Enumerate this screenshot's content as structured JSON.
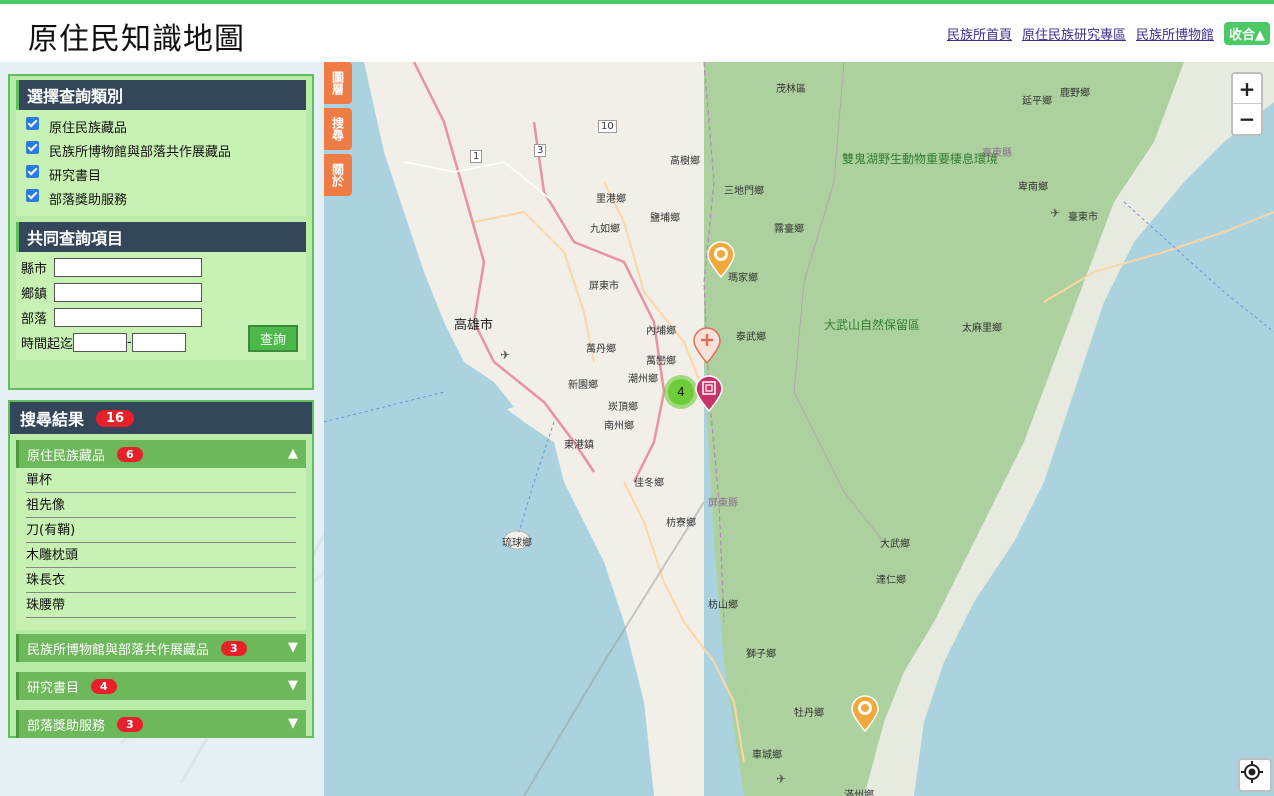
{
  "header": {
    "title": "原住民知識地圖",
    "links": [
      "民族所首頁",
      "原住民族研究專區",
      "民族所博物館"
    ],
    "collapse_label": "收合▲"
  },
  "category_panel": {
    "title": "選擇查詢類別",
    "options": [
      {
        "label": "原住民族藏品",
        "checked": true
      },
      {
        "label": "民族所博物館與部落共作展藏品",
        "checked": true
      },
      {
        "label": "研究書目",
        "checked": true
      },
      {
        "label": "部落獎助服務",
        "checked": true
      }
    ]
  },
  "query_panel": {
    "title": "共同查詢項目",
    "county_label": "縣市",
    "township_label": "鄉鎮",
    "tribe_label": "部落",
    "time_label": "時間起迄",
    "time_separator": "-",
    "submit_label": "查詢"
  },
  "results": {
    "title": "搜尋結果",
    "total": "16",
    "groups": [
      {
        "label": "原住民族藏品",
        "count": "6",
        "expanded": true,
        "arrow": "▲",
        "items": [
          "單杯",
          "祖先像",
          "刀(有鞘)",
          "木雕枕頭",
          "珠長衣",
          "珠腰帶"
        ]
      },
      {
        "label": "民族所博物館與部落共作展藏品",
        "count": "3",
        "expanded": false,
        "arrow": "▼"
      },
      {
        "label": "研究書目",
        "count": "4",
        "expanded": false,
        "arrow": "▼"
      },
      {
        "label": "部落獎助服務",
        "count": "3",
        "expanded": false,
        "arrow": "▼"
      }
    ]
  },
  "map": {
    "side_tabs": [
      "圖層",
      "搜尋",
      "關於"
    ],
    "zoom_in": "+",
    "zoom_out": "−",
    "cluster_count": "4",
    "labels": {
      "maolin": "茂林區",
      "yanping": "延平鄉",
      "luye": "鹿野鄉",
      "gaoshu": "高樹鄉",
      "sandimen": "三地門鄉",
      "ligang": "里港鄉",
      "yanpu": "鹽埔鄉",
      "jiuru": "九如鄉",
      "wutai": "霧臺鄉",
      "shuangui": "雙鬼湖野生動物重要棲息環境",
      "taitung_county": "臺東縣",
      "beinan": "卑南鄉",
      "taitung_city": "臺東市",
      "majia": "瑪家鄉",
      "pingtung_city": "屏東市",
      "kaohsiung": "高雄市",
      "neipu": "內埔鄉",
      "taiwu": "泰武鄉",
      "dawu_reserve": "大武山自然保留區",
      "taimali": "太麻里鄉",
      "wandan": "萬丹鄉",
      "wanluan": "萬巒鄉",
      "chaozhou": "潮州鄉",
      "xinyuan": "新園鄉",
      "kanding": "崁頂鄉",
      "nanzhou": "南州鄉",
      "donggang": "東港鎮",
      "jiadong": "佳冬鄉",
      "pingtung_county": "屏東縣",
      "fangliao": "枋寮鄉",
      "liuqiu": "琉球鄉",
      "dawu": "大武鄉",
      "daren": "達仁鄉",
      "fangshan": "枋山鄉",
      "shizi": "獅子鄉",
      "mudan": "牡丹鄉",
      "checheng": "車城鄉",
      "manzhou": "滿州鄉",
      "r1": "1",
      "r3": "3",
      "r10": "10"
    }
  },
  "colors": {
    "accent": "#4cc964",
    "panel_header": "#34465a",
    "panel_bg": "#c8f1b4",
    "group_header": "#6db85a",
    "badge": "#e8202a",
    "side_tab": "#ef7b45",
    "sea": "#aad3df",
    "land": "#f2efe9",
    "forest": "#add19e"
  }
}
